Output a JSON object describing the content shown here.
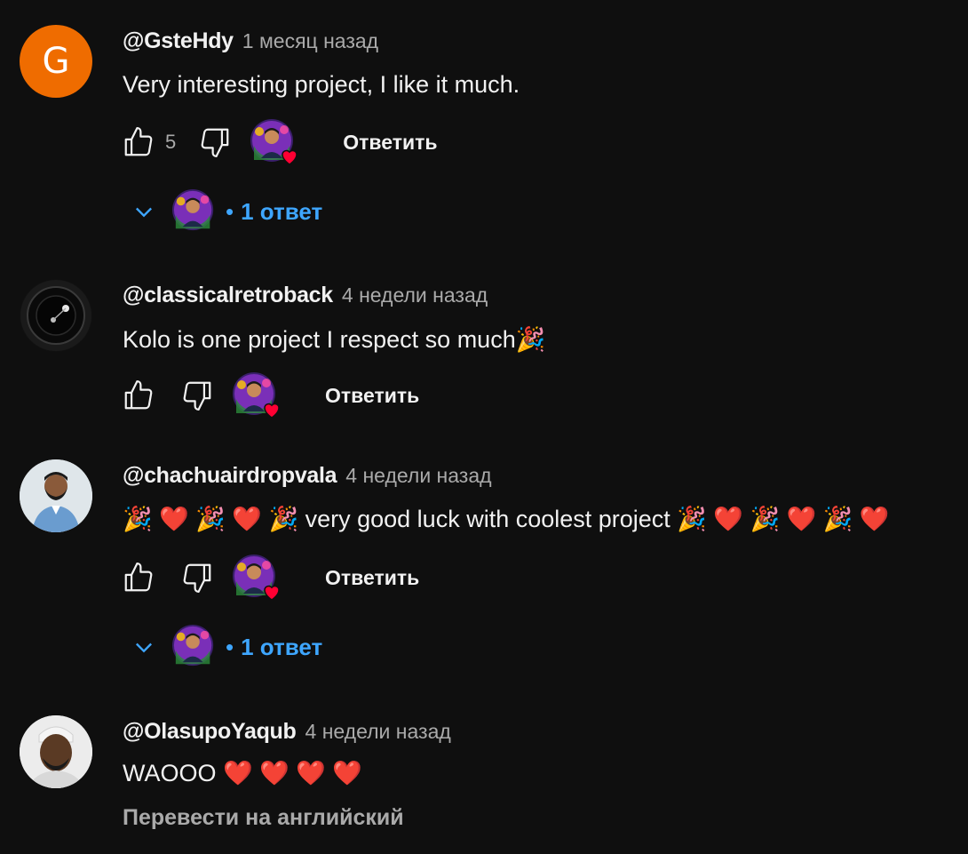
{
  "comments": [
    {
      "author": "@GsteHdy",
      "time": "1 месяц назад",
      "avatar_letter": "G",
      "text": "Very interesting project, I like it much.",
      "likes": "5",
      "reply_label": "Ответить",
      "replies_label": "1 ответ"
    },
    {
      "author": "@classicalretroback",
      "time": "4 недели назад",
      "text": "Kolo is one project I respect so much",
      "text_emoji": "🎉",
      "reply_label": "Ответить"
    },
    {
      "author": "@chachuairdropvala",
      "time": "4 недели назад",
      "text_prefix": "🎉 ❤️ 🎉 ❤️ 🎉",
      "text": " very good luck with coolest project ",
      "text_suffix": "🎉 ❤️ 🎉 ❤️ 🎉 ❤️",
      "reply_label": "Ответить",
      "replies_label": "1 ответ"
    },
    {
      "author": "@OlasupoYaqub",
      "time": "4 недели назад",
      "text": "WAOOO",
      "text_emoji": "❤️ ❤️ ❤️ ❤️",
      "translate_label": "Перевести на английский"
    }
  ],
  "colors": {
    "background": "#0f0f0f",
    "link": "#3ea6ff",
    "secondary": "#aaaaaa",
    "avatar_orange": "#ef6c00"
  }
}
